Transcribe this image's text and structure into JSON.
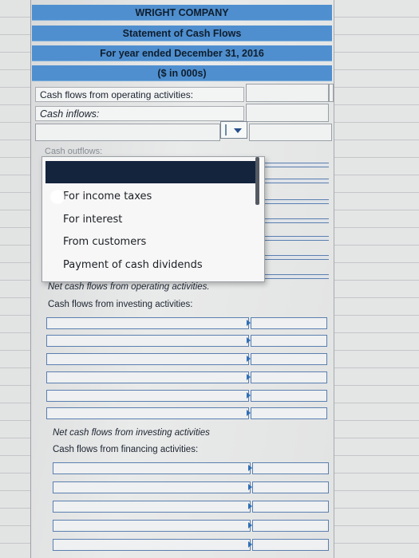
{
  "header": {
    "company": "WRIGHT COMPANY",
    "statement": "Statement of Cash Flows",
    "period": "For year ended December 31, 2016",
    "units": "($ in 000s)"
  },
  "operating": {
    "title": "Cash flows from operating activities:",
    "inflows_label": "Cash inflows:",
    "outflows_ghost": "Cash outflows:",
    "net_label": "Net cash flows from operating activities."
  },
  "dropdown": {
    "selected": "",
    "options": [
      "For income taxes",
      "For interest",
      "From customers",
      "Payment of cash dividends"
    ]
  },
  "investing": {
    "title": "Cash flows from investing activities:",
    "net_label": "Net cash flows from investing activities"
  },
  "financing": {
    "title": "Cash flows from financing activities:"
  }
}
